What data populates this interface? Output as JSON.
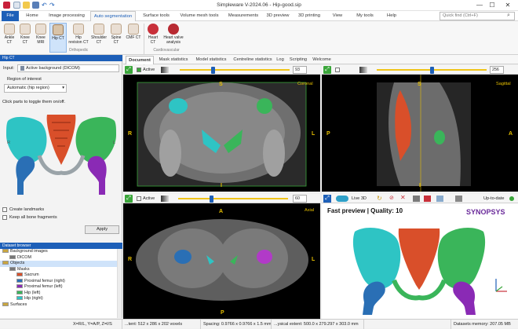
{
  "app": {
    "title": "Simpleware V-2024.06 - Hip-good.sip"
  },
  "window": {
    "minimize": "—",
    "maximize": "☐",
    "close": "✕"
  },
  "ribbon_tabs": [
    "File",
    "Home",
    "Image processing",
    "Auto segmentation",
    "Surface tools",
    "Volume mesh tools",
    "Measurements",
    "3D preview",
    "3D printing",
    "View",
    "My tools",
    "Help"
  ],
  "search": {
    "placeholder": "Quick find (Ctrl+F)"
  },
  "ribbon": {
    "orthopedic_buttons": [
      "Ankle CT",
      "Knee CT",
      "Knee MRI",
      "Hip CT",
      "Hip revision CT",
      "Shoulder CT",
      "Spine CT",
      "CMF CT"
    ],
    "cardio_buttons": [
      "Heart CT",
      "Heart valve analysis"
    ],
    "group_orthopedic": "Orthopedic",
    "group_cardio": "Cardiovascular"
  },
  "left_panel": {
    "header": "Hip CT",
    "input_label": "Input:",
    "input_value": "Active background (DICOM)",
    "roi_label": "Region of interest",
    "roi_value": "Automatic (hip region)",
    "instruction": "Click parts to toggle them on/off.",
    "side_r": "R",
    "side_l": "L",
    "create_landmarks": "Create landmarks",
    "keep_fragments": "Keep all bone fragments",
    "apply": "Apply"
  },
  "dataset_browser": {
    "header": "Dataset browser",
    "items": [
      {
        "label": "Background images",
        "level": 0,
        "color": "#c9a640"
      },
      {
        "label": "DICOM",
        "level": 1,
        "color": "#777777"
      },
      {
        "label": "Objects",
        "level": 0,
        "color": "#c9a640",
        "selected": true
      },
      {
        "label": "Masks",
        "level": 1,
        "color": "#777777"
      },
      {
        "label": "Sacrum",
        "level": 2,
        "color": "#d94f2a"
      },
      {
        "label": "Proximal femur (right)",
        "level": 2,
        "color": "#2a6fb5"
      },
      {
        "label": "Proximal femur (left)",
        "level": 2,
        "color": "#8a2ab5"
      },
      {
        "label": "Hip (left)",
        "level": 2,
        "color": "#3ab55a"
      },
      {
        "label": "Hip (right)",
        "level": 2,
        "color": "#2ec4c4"
      },
      {
        "label": "Surfaces",
        "level": 0,
        "color": "#c9a640"
      }
    ]
  },
  "doc_tabs": [
    "Document",
    "Mask statistics",
    "Model statistics",
    "Centreline statistics",
    "Log",
    "Scripting",
    "Welcome"
  ],
  "views": {
    "coronal": {
      "name": "Coronal",
      "active_label": "Active",
      "slice": "93",
      "top": "S",
      "bottom": "I",
      "left": "R",
      "right": "L"
    },
    "sagittal": {
      "name": "Sagittal",
      "slice": "256",
      "top": "S",
      "bottom": "I",
      "left": "P",
      "right": "A"
    },
    "axial": {
      "name": "Axial",
      "active_label": "Active",
      "slice": "60",
      "top": "A",
      "bottom": "P",
      "left": "R",
      "right": "L"
    },
    "preview3d": {
      "live_label": "Live 3D",
      "status": "Up-to-date",
      "title": "Fast preview | Quality: 10",
      "brand": "SYNOPSYS"
    }
  },
  "status_bar": {
    "coords": "X=R/L, Y=A/P, Z=I/S",
    "extent": "...tent: 512 x 286 x 202 voxels",
    "spacing": "Spacing: 0.9766 x 0.9766 x 1.5 mm",
    "physical": "...ysical extent: 500.0 x 279.297 x 303.0 mm",
    "memory": "Datasets memory: 207.05 MB"
  },
  "colors": {
    "accent": "#1d5fb8",
    "active_green": "#3aa63a",
    "slice_yellow": "#e8c000",
    "sacrum": "#d94f2a",
    "hip_left": "#3ab55a",
    "hip_right": "#2ec4c4",
    "femur_right": "#2a6fb5",
    "femur_left": "#8a2ab5"
  },
  "icons": [
    "app-icon",
    "search-icon",
    "maximize-view-icon",
    "active-checkbox-icon",
    "colormap-icon",
    "axis-gizmo-icon",
    "refresh-icon"
  ]
}
